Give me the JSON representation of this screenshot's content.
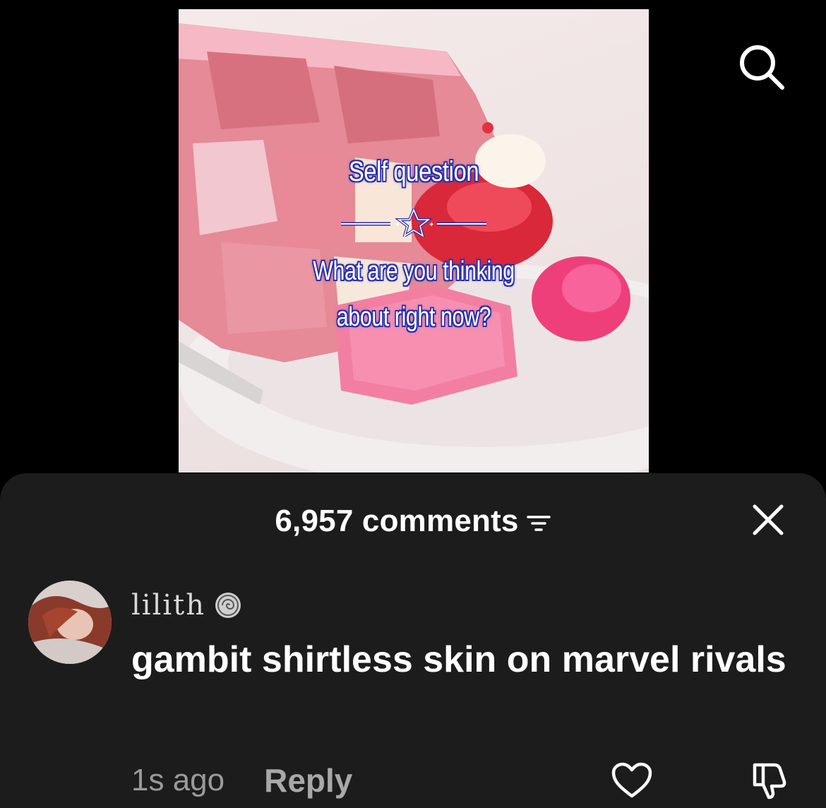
{
  "video": {
    "overlay_title": "Self question",
    "overlay_question_line1": "What are you thinking",
    "overlay_question_line2": "about right now?",
    "background_colors": {
      "cake": "#e07a8a",
      "frosting": "#f4a9b8",
      "plate": "#f1ebeb"
    }
  },
  "top_bar": {
    "search_icon": "search-icon"
  },
  "comments_sheet": {
    "count_label": "6,957 comments",
    "sort_icon": "sort-filter-icon",
    "close_icon": "close-icon",
    "background": "#1c1c1c"
  },
  "comments": [
    {
      "username": "lilith",
      "badge_icon": "spiral-badge-icon",
      "text": "gambit shirtless skin on marvel rivals",
      "timestamp": "1s ago",
      "reply_label": "Reply",
      "like_icon": "heart-outline-icon",
      "dislike_icon": "thumbs-down-outline-icon"
    }
  ]
}
